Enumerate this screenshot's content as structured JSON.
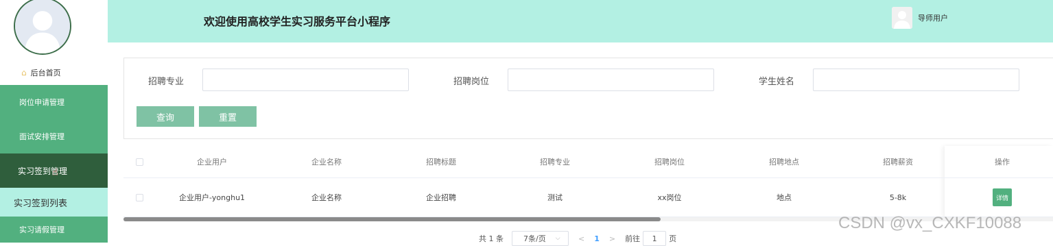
{
  "header": {
    "title": "欢迎使用高校学生实习服务平台小程序",
    "user_name": "导师用户"
  },
  "sidebar": {
    "home_label": "后台首页",
    "items": [
      {
        "label": "岗位申请管理"
      },
      {
        "label": "面试安排管理"
      },
      {
        "label": "实习签到管理"
      },
      {
        "label": "实习签到列表"
      },
      {
        "label": "实习请假管理"
      }
    ]
  },
  "search": {
    "fields": [
      {
        "label": "招聘专业"
      },
      {
        "label": "招聘岗位"
      },
      {
        "label": "学生姓名"
      }
    ],
    "query_label": "查询",
    "reset_label": "重置"
  },
  "table": {
    "columns": [
      "企业用户",
      "企业名称",
      "招聘标题",
      "招聘专业",
      "招聘岗位",
      "招聘地点",
      "招聘薪资",
      "操作"
    ],
    "rows": [
      {
        "cells": [
          "企业用户-yonghu1",
          "企业名称",
          "企业招聘",
          "测试",
          "xx岗位",
          "地点",
          "5-8k"
        ],
        "action": "详情"
      }
    ]
  },
  "pagination": {
    "total": "共 1 条",
    "page_size": "7条/页",
    "prev": "<",
    "current": "1",
    "next": ">",
    "goto_prefix": "前往",
    "goto_value": "1",
    "goto_suffix": "页"
  },
  "watermark": "CSDN @vx_CXKF10088",
  "colors": {
    "primary": "#52b07f",
    "active": "#2f5e3c",
    "header": "#b3f0e3",
    "button": "#7fc2a4"
  },
  "scrollbar": {
    "horizontal_visible_fraction": 0.58
  }
}
